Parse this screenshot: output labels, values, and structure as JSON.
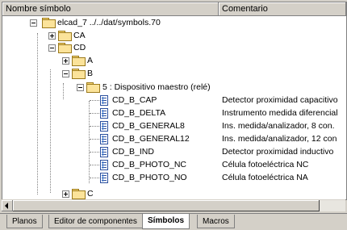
{
  "header": {
    "col_symbol": "Nombre símbolo",
    "col_comment": "Comentario"
  },
  "tree": {
    "root": "elcad_7   ../../dat/symbols.70",
    "ca": "CA",
    "cd": "CD",
    "a": "A",
    "b": "B",
    "group5": "5 : Dispositivo maestro (relé)",
    "c": "C",
    "symbols": [
      {
        "name": "CD_B_CAP",
        "comment": "Detector proximidad capacitivo"
      },
      {
        "name": "CD_B_DELTA",
        "comment": "Instrumento medida diferencial"
      },
      {
        "name": "CD_B_GENERAL8",
        "comment": "Ins. medida/analizador, 8 con."
      },
      {
        "name": "CD_B_GENERAL12",
        "comment": "Ins. medida/analizador, 12 con"
      },
      {
        "name": "CD_B_IND",
        "comment": "Detector proximidad inductivo"
      },
      {
        "name": "CD_B_PHOTO_NC",
        "comment": "Célula fotoeléctrica NC"
      },
      {
        "name": "CD_B_PHOTO_NO",
        "comment": "Célula fotoeléctrica NA"
      }
    ]
  },
  "tabs": [
    "Planos",
    "Editor de componentes",
    "Símbolos",
    "Macros"
  ],
  "active_tab": "Símbolos"
}
